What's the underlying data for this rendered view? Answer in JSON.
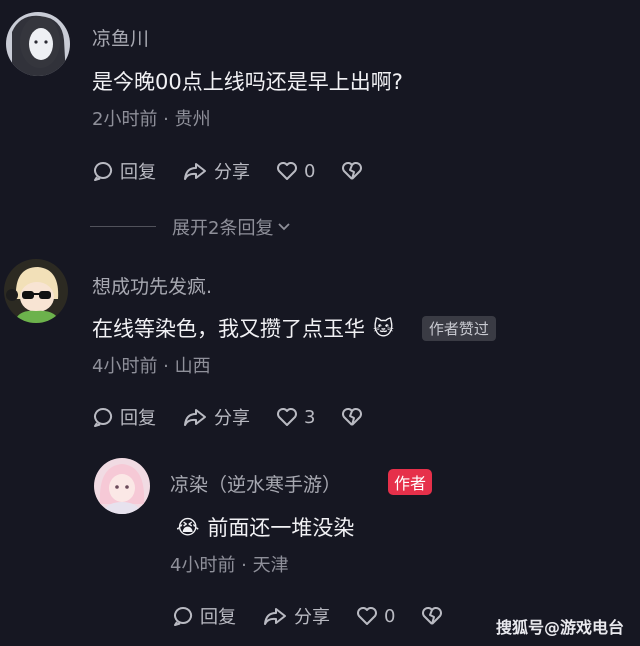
{
  "comments": [
    {
      "author": "凉鱼川",
      "text": "是今晚00点上线吗还是早上出啊?",
      "time_location": "2小时前 · 贵州",
      "reply_label": "回复",
      "share_label": "分享",
      "like_count": "0"
    },
    {
      "author": "想成功先发疯.",
      "text": "在线等染色，我又攒了点玉华",
      "emoji": "🐱",
      "liked_badge": "作者赞过",
      "time_location": "4小时前 · 山西",
      "reply_label": "回复",
      "share_label": "分享",
      "like_count": "3"
    }
  ],
  "expand_replies": {
    "label": "展开2条回复"
  },
  "reply": {
    "author": "凉染（逆水寒手游）",
    "author_badge": "作者",
    "emoji": "😭",
    "text": "前面还一堆没染",
    "time_location": "4小时前 · 天津",
    "reply_label": "回复",
    "share_label": "分享",
    "like_count": "0"
  },
  "watermark": "搜狐号@游戏电台",
  "colors": {
    "background": "#161722",
    "author_badge": "#e6304a"
  }
}
